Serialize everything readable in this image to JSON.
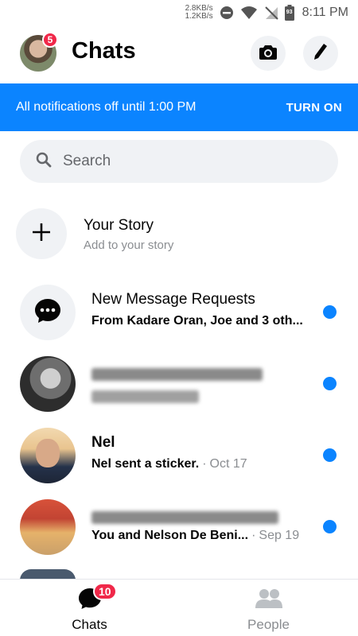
{
  "status_bar": {
    "speed_up": "2.8KB/s",
    "speed_down": "1.2KB/s",
    "battery": "93",
    "time": "8:11 PM"
  },
  "header": {
    "title": "Chats",
    "avatar_badge": "5",
    "camera_icon": "camera-icon",
    "compose_icon": "pencil-icon"
  },
  "banner": {
    "text": "All notifications off until 1:00 PM",
    "action": "TURN ON",
    "color": "#0B84FF"
  },
  "search": {
    "placeholder": "Search"
  },
  "story": {
    "title": "Your Story",
    "subtitle": "Add to your story"
  },
  "chats": [
    {
      "name": "New Message Requests",
      "preview": "From Kadare Oran, Joe and 3 oth...",
      "date": "",
      "unread": true
    },
    {
      "name": "",
      "preview": "",
      "date": "",
      "unread": true
    },
    {
      "name": "Nel",
      "preview": "Nel sent a sticker.",
      "date": "Oct 17",
      "unread": true
    },
    {
      "name": "",
      "preview": "You and Nelson De Beni...",
      "date": "Sep 19",
      "unread": true
    }
  ],
  "bottom_nav": {
    "chats_label": "Chats",
    "chats_badge": "10",
    "people_label": "People"
  },
  "colors": {
    "accent": "#0B84FF",
    "badge": "#F02849"
  }
}
